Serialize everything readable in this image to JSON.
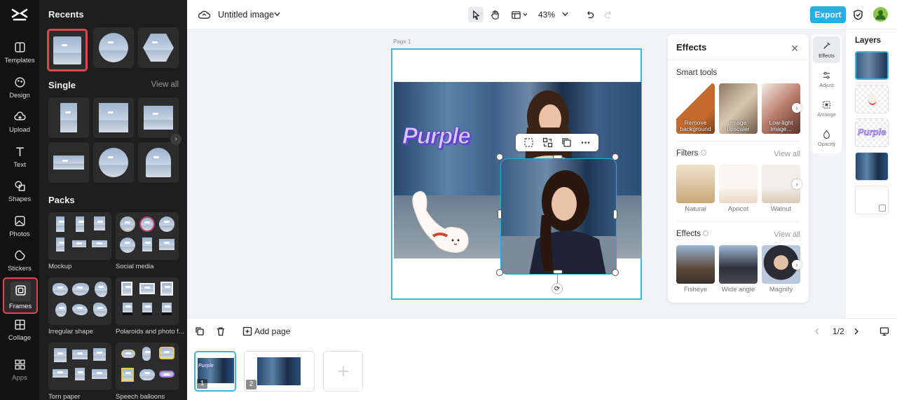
{
  "app": {
    "title": "Untitled image",
    "export_label": "Export",
    "zoom": "43%"
  },
  "rail": [
    {
      "id": "templates",
      "label": "Templates",
      "icon": "templates-icon"
    },
    {
      "id": "design",
      "label": "Design",
      "icon": "design-icon"
    },
    {
      "id": "upload",
      "label": "Upload",
      "icon": "upload-icon"
    },
    {
      "id": "text",
      "label": "Text",
      "icon": "text-icon"
    },
    {
      "id": "shapes",
      "label": "Shapes",
      "icon": "shapes-icon"
    },
    {
      "id": "photos",
      "label": "Photos",
      "icon": "photos-icon"
    },
    {
      "id": "stickers",
      "label": "Stickers",
      "icon": "stickers-icon"
    },
    {
      "id": "frames",
      "label": "Frames",
      "icon": "frames-icon",
      "active": true
    },
    {
      "id": "collage",
      "label": "Collage",
      "icon": "collage-icon"
    },
    {
      "id": "apps",
      "label": "Apps",
      "icon": "apps-icon"
    }
  ],
  "library": {
    "recents_title": "Recents",
    "single_title": "Single",
    "single_viewall": "View all",
    "packs_title": "Packs",
    "packs": [
      "Mockup",
      "Social media",
      "Irregular shape",
      "Polaroids and photo f...",
      "Torn paper",
      "Speech balloons"
    ]
  },
  "canvas": {
    "page_label": "Page 1",
    "headline": "Purple"
  },
  "effects": {
    "title": "Effects",
    "smart_tools_title": "Smart tools",
    "smart_tools": [
      "Remove background",
      "Image upscaler",
      "Low-light image..."
    ],
    "filters_title": "Filters",
    "filters_viewall": "View all",
    "filters": [
      "Natural",
      "Apricot",
      "Walnut"
    ],
    "effects_title": "Effects",
    "effects_viewall": "View all",
    "effects_items": [
      "Fisheye",
      "Wide angle",
      "Magnify"
    ]
  },
  "side_tabs": [
    {
      "label": "Effects",
      "icon": "effects-icon",
      "active": true
    },
    {
      "label": "Adjust",
      "icon": "adjust-icon"
    },
    {
      "label": "Arrange",
      "icon": "arrange-icon"
    },
    {
      "label": "Opacity",
      "icon": "opacity-icon"
    }
  ],
  "layers": {
    "title": "Layers"
  },
  "bottom": {
    "add_page": "Add page",
    "pager": "1/2"
  },
  "filmstrip": {
    "pages": [
      "1",
      "2"
    ]
  }
}
